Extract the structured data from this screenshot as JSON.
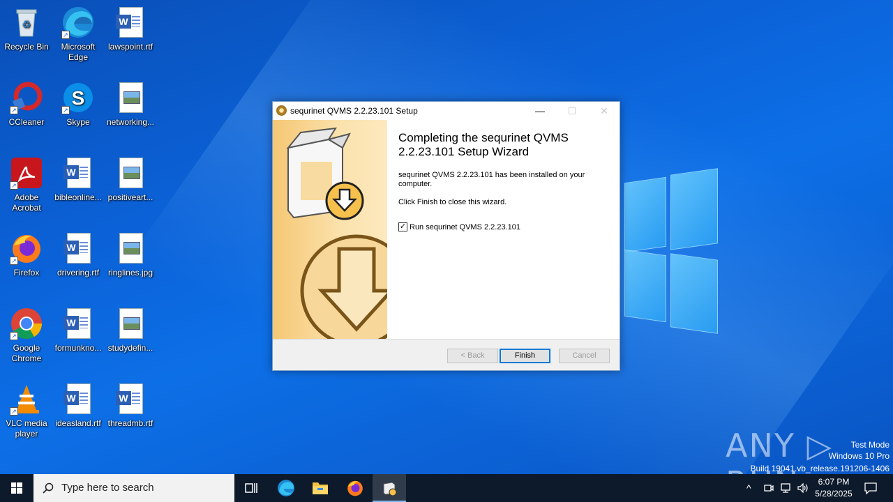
{
  "desktop": {
    "icons": [
      {
        "label": "Recycle Bin"
      },
      {
        "label": "Microsoft Edge"
      },
      {
        "label": "lawspoint.rtf"
      },
      {
        "label": "CCleaner"
      },
      {
        "label": "Skype"
      },
      {
        "label": "networking..."
      },
      {
        "label": "Adobe Acrobat"
      },
      {
        "label": "bibleonline..."
      },
      {
        "label": "positiveart..."
      },
      {
        "label": "Firefox"
      },
      {
        "label": "drivering.rtf"
      },
      {
        "label": "ringlines.jpg"
      },
      {
        "label": "Google Chrome"
      },
      {
        "label": "formunkno..."
      },
      {
        "label": "studydefin..."
      },
      {
        "label": "VLC media player"
      },
      {
        "label": "ideasland.rtf"
      },
      {
        "label": "threadmb.rtf"
      }
    ]
  },
  "dialog": {
    "title": "sequrinet QVMS 2.2.23.101 Setup",
    "heading": "Completing the sequrinet QVMS 2.2.23.101 Setup Wizard",
    "message1": "sequrinet QVMS 2.2.23.101 has been installed on your computer.",
    "message2": "Click Finish to close this wizard.",
    "checkbox_label": "Run sequrinet QVMS 2.2.23.101",
    "checkbox_checked": true,
    "back_label": "< Back",
    "finish_label": "Finish",
    "cancel_label": "Cancel",
    "minimize_glyph": "—",
    "maximize_glyph": "☐",
    "close_glyph": "✕"
  },
  "watermark": {
    "brand": "ANY ▷ RUN",
    "mode": "Test Mode",
    "os": "Windows 10 Pro",
    "build": "Build 19041.vb_release.191206-1406"
  },
  "taskbar": {
    "search_placeholder": "Type here to search",
    "time": "6:07 PM",
    "date": "5/28/2025"
  },
  "colors": {
    "accent": "#0078d7",
    "taskbar": "#0d1a2b",
    "wallpaper": "#0b62d8"
  }
}
